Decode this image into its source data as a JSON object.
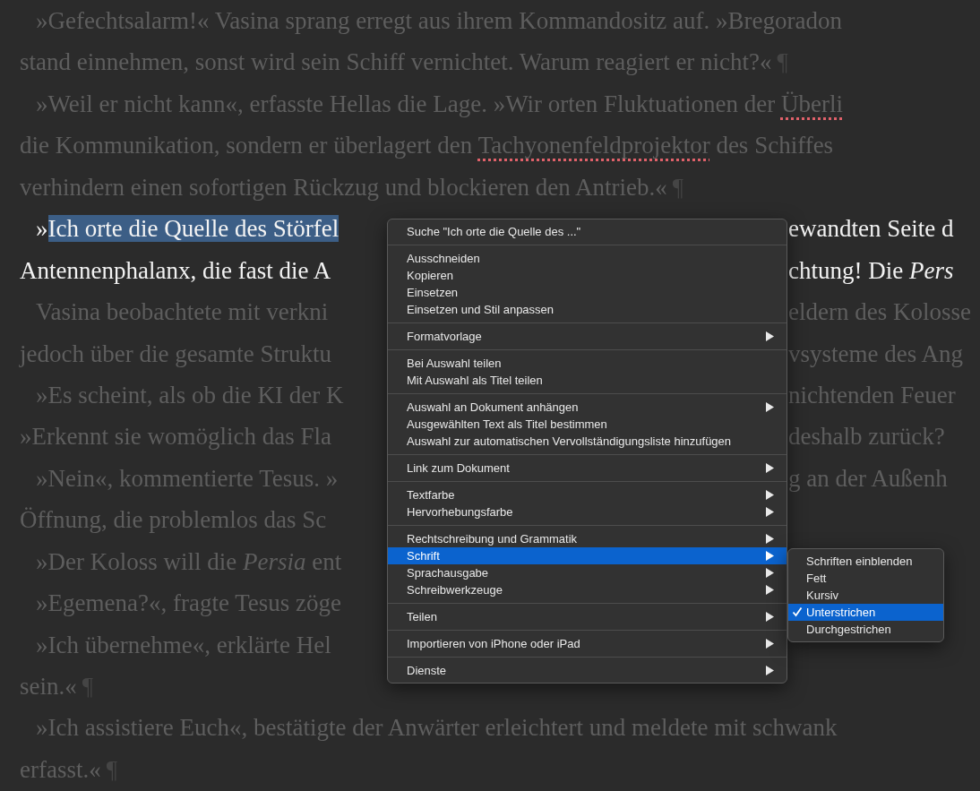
{
  "document": {
    "lines": [
      {
        "indent": true,
        "focused": false,
        "left": [
          {
            "kind": "plain",
            "text": "»Gefechtsalarm!« Vasina sprang erregt aus ihrem Kommandositz auf. »Bregoradon"
          }
        ]
      },
      {
        "indent": false,
        "focused": false,
        "left": [
          {
            "kind": "plain",
            "text": "stand einnehmen, sonst wird sein Schiff vernichtet. Warum reagiert er nicht?«"
          },
          {
            "kind": "mark",
            "text": "¶"
          }
        ]
      },
      {
        "indent": true,
        "focused": false,
        "left": [
          {
            "kind": "plain",
            "text": "»Weil er nicht kann«, erfasste Hellas die Lage. »Wir orten Fluktuationen der "
          },
          {
            "kind": "misspelled",
            "text": "Überli"
          }
        ]
      },
      {
        "indent": false,
        "focused": false,
        "left": [
          {
            "kind": "plain",
            "text": "die Kommunikation, sondern er überlagert den "
          },
          {
            "kind": "misspelled",
            "text": "Tachyonenfeldprojektor"
          },
          {
            "kind": "plain",
            "text": " des Schiffes"
          }
        ]
      },
      {
        "indent": false,
        "focused": false,
        "left": [
          {
            "kind": "plain",
            "text": "verhindern einen sofortigen Rückzug und blockieren den Antrieb.«"
          },
          {
            "kind": "mark",
            "text": "¶"
          }
        ]
      },
      {
        "indent": true,
        "focused": true,
        "left": [
          {
            "kind": "plain",
            "text": "»"
          },
          {
            "kind": "selected",
            "text": "Ich orte die Quelle des Störfel"
          }
        ],
        "right": [
          {
            "kind": "plain",
            "text": "ewandten Seite d"
          }
        ]
      },
      {
        "indent": false,
        "focused": true,
        "left": [
          {
            "kind": "plain",
            "text": "Antennenphalanx, die fast die A"
          }
        ],
        "right": [
          {
            "kind": "plain",
            "text": "chtung! Die *Pers*"
          }
        ]
      },
      {
        "indent": true,
        "focused": false,
        "left": [
          {
            "kind": "plain",
            "text": "Vasina beobachtete mit verkni"
          }
        ],
        "right": [
          {
            "kind": "plain",
            "text": "eldern des Kolosse"
          }
        ]
      },
      {
        "indent": false,
        "focused": false,
        "left": [
          {
            "kind": "plain",
            "text": "jedoch über die gesamte Struktu"
          }
        ],
        "right": [
          {
            "kind": "plain",
            "text": "vsysteme des Ang"
          }
        ]
      },
      {
        "indent": true,
        "focused": false,
        "left": [
          {
            "kind": "plain",
            "text": "»Es scheint, als ob die KI der K"
          }
        ],
        "right": [
          {
            "kind": "plain",
            "text": "nichtenden Feuer"
          }
        ]
      },
      {
        "indent": false,
        "focused": false,
        "left": [
          {
            "kind": "plain",
            "text": "»Erkennt sie womöglich das Fla"
          }
        ],
        "right": [
          {
            "kind": "plain",
            "text": "deshalb zurück?"
          }
        ]
      },
      {
        "indent": true,
        "focused": false,
        "left": [
          {
            "kind": "plain",
            "text": "»Nein«, kommentierte Tesus. »"
          }
        ],
        "right": [
          {
            "kind": "plain",
            "text": "g an der Außenh"
          }
        ]
      },
      {
        "indent": false,
        "focused": false,
        "left": [
          {
            "kind": "plain",
            "text": "Öffnung, die problemlos das Sc"
          }
        ]
      },
      {
        "indent": true,
        "focused": false,
        "left": [
          {
            "kind": "plain",
            "text": "»Der Koloss will die *Persia* ent"
          }
        ]
      },
      {
        "indent": true,
        "focused": false,
        "left": [
          {
            "kind": "plain",
            "text": "»Egemena?«, fragte Tesus zöge"
          }
        ]
      },
      {
        "indent": true,
        "focused": false,
        "left": [
          {
            "kind": "plain",
            "text": "»Ich übernehme«, erklärte Hel"
          }
        ]
      },
      {
        "indent": false,
        "focused": false,
        "left": [
          {
            "kind": "plain",
            "text": "sein.«"
          },
          {
            "kind": "mark",
            "text": "¶"
          }
        ]
      },
      {
        "indent": true,
        "focused": false,
        "left": [
          {
            "kind": "plain",
            "text": "»Ich assistiere Euch«, bestätigte der Anwärter erleichtert und meldete mit schwank"
          }
        ]
      },
      {
        "indent": false,
        "focused": false,
        "left": [
          {
            "kind": "plain",
            "text": "erfasst.«"
          },
          {
            "kind": "mark",
            "text": "¶"
          }
        ]
      }
    ]
  },
  "context_menu": {
    "groups": [
      [
        {
          "label": "Suche \"Ich orte die Quelle des ...\"",
          "has_submenu": false,
          "selected": false
        }
      ],
      [
        {
          "label": "Ausschneiden",
          "has_submenu": false,
          "selected": false
        },
        {
          "label": "Kopieren",
          "has_submenu": false,
          "selected": false
        },
        {
          "label": "Einsetzen",
          "has_submenu": false,
          "selected": false
        },
        {
          "label": "Einsetzen und Stil anpassen",
          "has_submenu": false,
          "selected": false
        }
      ],
      [
        {
          "label": "Formatvorlage",
          "has_submenu": true,
          "selected": false
        }
      ],
      [
        {
          "label": "Bei Auswahl teilen",
          "has_submenu": false,
          "selected": false
        },
        {
          "label": "Mit Auswahl als Titel teilen",
          "has_submenu": false,
          "selected": false
        }
      ],
      [
        {
          "label": "Auswahl an Dokument anhängen",
          "has_submenu": true,
          "selected": false
        },
        {
          "label": "Ausgewählten Text als Titel bestimmen",
          "has_submenu": false,
          "selected": false
        },
        {
          "label": "Auswahl zur automatischen Vervollständigungsliste hinzufügen",
          "has_submenu": false,
          "selected": false
        }
      ],
      [
        {
          "label": "Link zum Dokument",
          "has_submenu": true,
          "selected": false
        }
      ],
      [
        {
          "label": "Textfarbe",
          "has_submenu": true,
          "selected": false
        },
        {
          "label": "Hervorhebungsfarbe",
          "has_submenu": true,
          "selected": false
        }
      ],
      [
        {
          "label": "Rechtschreibung und Grammatik",
          "has_submenu": true,
          "selected": false
        },
        {
          "label": "Schrift",
          "has_submenu": true,
          "selected": true
        },
        {
          "label": "Sprachausgabe",
          "has_submenu": true,
          "selected": false
        },
        {
          "label": "Schreibwerkzeuge",
          "has_submenu": true,
          "selected": false
        }
      ],
      [
        {
          "label": "Teilen",
          "has_submenu": true,
          "selected": false
        }
      ],
      [
        {
          "label": "Importieren von iPhone oder iPad",
          "has_submenu": true,
          "selected": false
        }
      ],
      [
        {
          "label": "Dienste",
          "has_submenu": true,
          "selected": false
        }
      ]
    ]
  },
  "submenu": {
    "items": [
      {
        "label": "Schriften einblenden",
        "checked": false,
        "selected": false
      },
      {
        "label": "Fett",
        "checked": false,
        "selected": false
      },
      {
        "label": "Kursiv",
        "checked": false,
        "selected": false
      },
      {
        "label": "Unterstrichen",
        "checked": true,
        "selected": true
      },
      {
        "label": "Durchgestrichen",
        "checked": false,
        "selected": false
      }
    ]
  }
}
